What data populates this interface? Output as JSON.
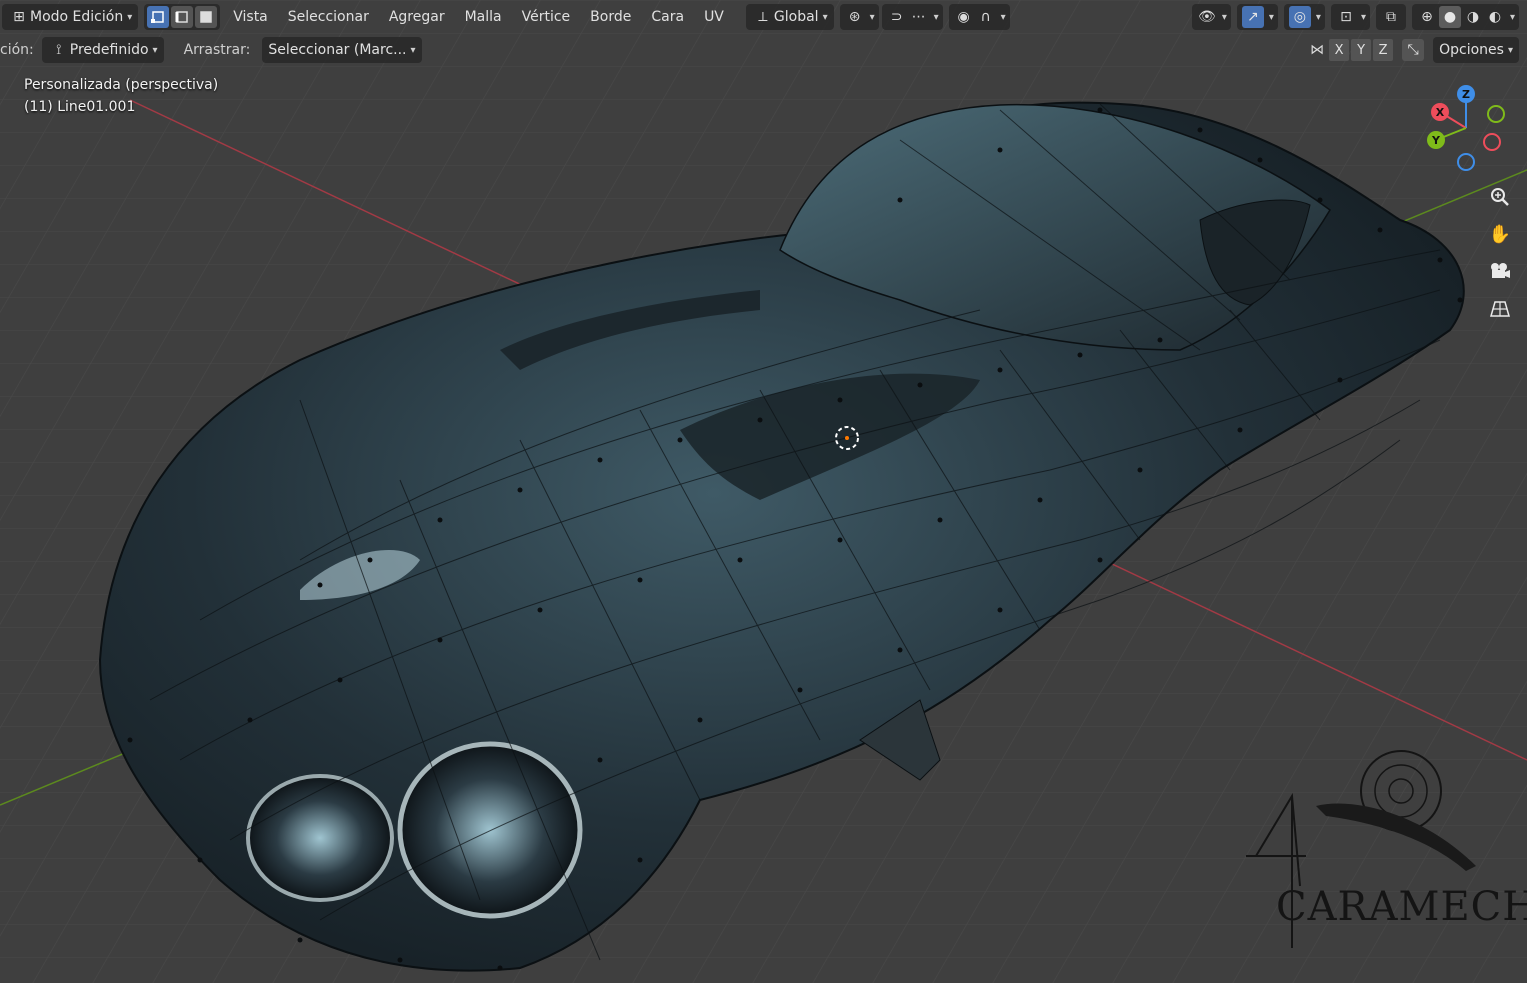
{
  "header": {
    "mode_label": "Modo Edición",
    "menus": [
      "Vista",
      "Seleccionar",
      "Agregar",
      "Malla",
      "Vértice",
      "Borde",
      "Cara",
      "UV"
    ],
    "transform_orientation": "Global",
    "icons": {
      "editor_type": "editor-type-icon",
      "select_vertex": "vertex-select-icon",
      "select_edge": "edge-select-icon",
      "select_face": "face-select-icon",
      "orientation": "transform-orientation-icon",
      "pivot": "pivot-point-icon",
      "snap": "snap-magnet-icon",
      "snap_target": "snap-increment-icon",
      "proportional": "proportional-edit-icon",
      "falloff": "falloff-curve-icon",
      "visibility": "eye-visibility-icon",
      "gizmo": "gizmo-arrow-icon",
      "overlay": "overlay-circles-icon",
      "mesh_edit_overlay": "mesh-overlay-icon",
      "xray": "xray-toggle-icon",
      "shading_wire": "wireframe-sphere-icon",
      "shading_solid": "solid-sphere-icon",
      "shading_material": "material-sphere-icon",
      "shading_render": "render-sphere-icon"
    }
  },
  "tool_header": {
    "orientation_label_partial": "ción:",
    "orientation_value": "Predefinido",
    "drag_label": "Arrastrar:",
    "drag_value": "Seleccionar (Marc...",
    "mirror_axes": [
      "X",
      "Y",
      "Z"
    ],
    "options_label": "Opciones"
  },
  "viewport": {
    "view_name": "Personalizada (perspectiva)",
    "object_name": "(11) Line01.001",
    "gizmo_axes": {
      "x": "X",
      "y": "Y",
      "z": "Z"
    },
    "nav_buttons": [
      "zoom-icon",
      "hand-pan-icon",
      "camera-icon",
      "grid-perspective-icon"
    ]
  },
  "watermark": {
    "text": "CARAMECHA",
    "initial": "A"
  },
  "colors": {
    "accent_blue": "#4772b3",
    "axis_x": "#ee4d5b",
    "axis_y": "#7fbb1a",
    "axis_z": "#3f8ee8",
    "background": "#3f3f3f"
  }
}
